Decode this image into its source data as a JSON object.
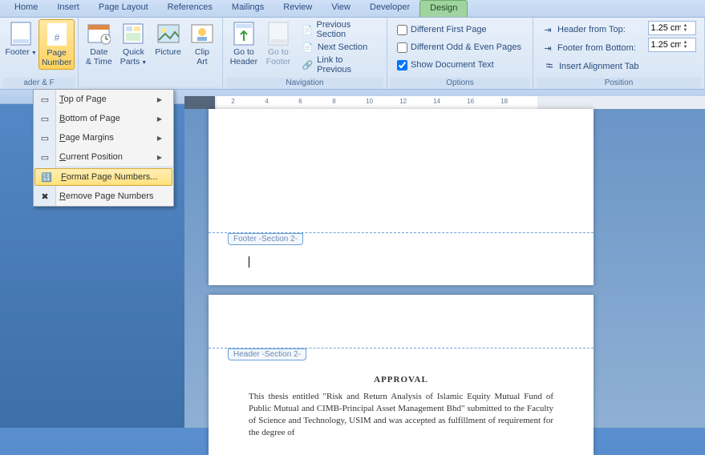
{
  "tabs": [
    "Home",
    "Insert",
    "Page Layout",
    "References",
    "Mailings",
    "Review",
    "View",
    "Developer",
    "Design"
  ],
  "ribbon": {
    "hf": {
      "footer": "Footer",
      "page_number": "Page\nNumber",
      "group": "ader & F"
    },
    "insert": {
      "date": "Date\n& Time",
      "quick": "Quick\nParts",
      "picture": "Picture",
      "clip": "Clip\nArt"
    },
    "nav": {
      "goto_header": "Go to\nHeader",
      "goto_footer": "Go to\nFooter",
      "prev": "Previous Section",
      "next": "Next Section",
      "link": "Link to Previous",
      "group": "Navigation"
    },
    "options": {
      "dfp": "Different First Page",
      "doe": "Different Odd & Even Pages",
      "sdt": "Show Document Text",
      "group": "Options"
    },
    "position": {
      "hft": "Header from Top:",
      "ffb": "Footer from Bottom:",
      "iat": "Insert Alignment Tab",
      "v1": "1.25 cm",
      "v2": "1.25 cm",
      "group": "Position"
    }
  },
  "menu": {
    "top": "Top of Page",
    "bottom": "Bottom of Page",
    "margins": "Page Margins",
    "current": "Current Position",
    "format": "Format Page Numbers...",
    "remove": "Remove Page Numbers"
  },
  "ruler_marks": [
    "2",
    "4",
    "6",
    "8",
    "10",
    "12",
    "14",
    "16",
    "18"
  ],
  "docs": {
    "footer_tag": "Footer -Section 2-",
    "header_tag": "Header -Section 2-",
    "approval": "APPROVAL",
    "body": "This thesis entitled \"Risk and Return Analysis of Islamic Equity Mutual Fund of Public Mutual and CIMB-Principal Asset Management Bhd\" submitted to the Faculty of Science and Technology, USIM and was accepted as fulfillment of requirement for the degree of"
  }
}
